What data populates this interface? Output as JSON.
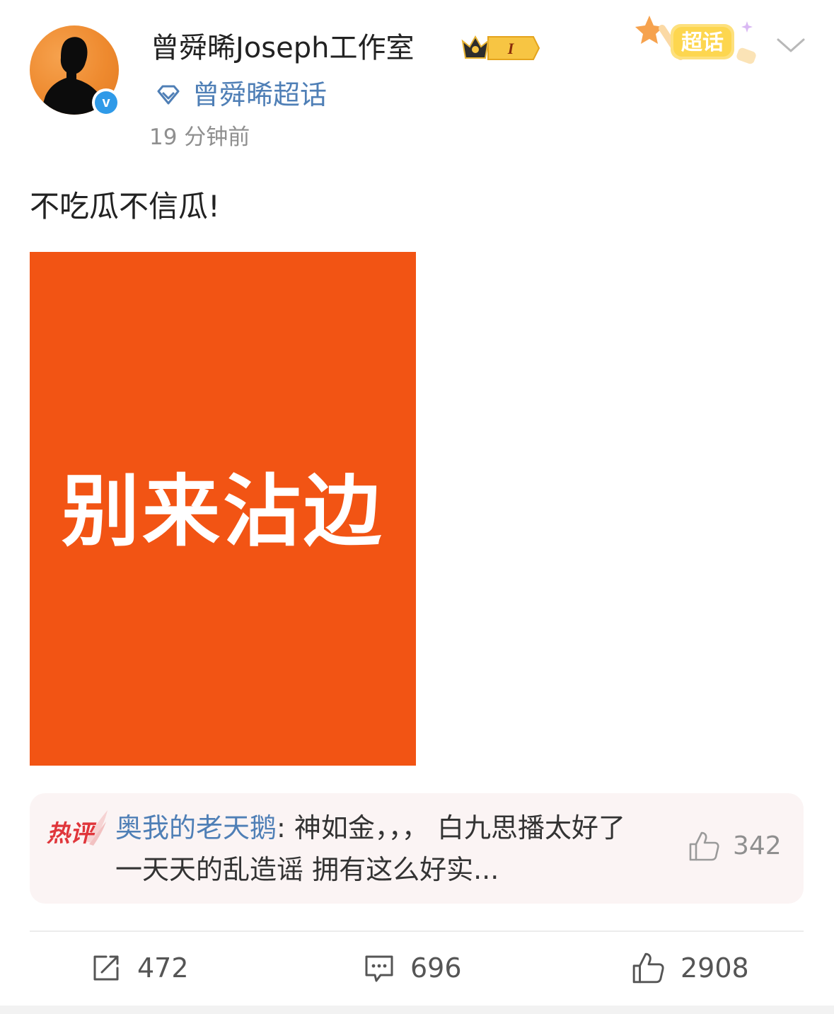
{
  "header": {
    "username": "曾舜晞Joseph工作室",
    "badge_level": "I",
    "supertopic_label": "曾舜晞超话",
    "timestamp": "19 分钟前",
    "verified_mark": "v",
    "chaohua_badge_label": "超话"
  },
  "post": {
    "text": "不吃瓜不信瓜!",
    "image_text": "别来沾边",
    "image_color": "#f25414"
  },
  "hot_comment": {
    "tag": "热评",
    "author": "奥我的老天鹅",
    "separator": ": ",
    "text": "神如金，，，  白九思播太好了 一天天的乱造谣 拥有这么好实...",
    "likes": "342"
  },
  "actions": {
    "reposts": "472",
    "comments": "696",
    "likes": "2908"
  },
  "colors": {
    "link_blue": "#4f7fb6",
    "hot_red": "#e0363b",
    "verified_blue": "#2f9ae8"
  },
  "icons": {
    "repost": "repost-icon",
    "comment": "comment-icon",
    "like": "thumbs-up-icon",
    "supertopic": "diamond-icon",
    "chevron": "chevron-down-icon"
  }
}
